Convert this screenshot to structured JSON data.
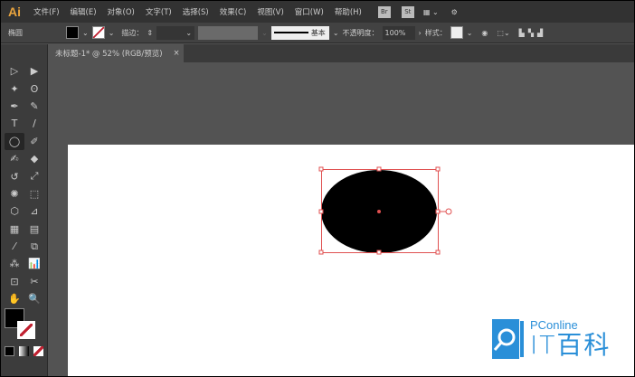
{
  "app": {
    "logo": "Ai"
  },
  "menu": [
    "文件(F)",
    "编辑(E)",
    "对象(O)",
    "文字(T)",
    "选择(S)",
    "效果(C)",
    "视图(V)",
    "窗口(W)",
    "帮助(H)"
  ],
  "menu_icons": [
    "Br",
    "St"
  ],
  "control": {
    "object_type": "椭圆",
    "stroke_label": "描边：",
    "stroke_style": "基本",
    "opacity_label": "不透明度：",
    "opacity_value": "100%",
    "style_label": "样式："
  },
  "document_tab": {
    "title": "未标题-1* @ 52% (RGB/预览)",
    "close": "×"
  },
  "tools": [
    "selection",
    "direct-selection",
    "magic-wand",
    "lasso",
    "pen",
    "curvature",
    "type",
    "line",
    "ellipse",
    "paintbrush",
    "shaper",
    "eraser",
    "rotate",
    "scale",
    "warp",
    "free-transform",
    "shape-builder",
    "perspective",
    "mesh",
    "gradient",
    "eyedropper",
    "blend",
    "symbol-sprayer",
    "column-graph",
    "artboard",
    "slice",
    "hand",
    "zoom"
  ],
  "tool_glyphs": [
    "▷",
    "▶",
    "✦",
    "ʘ",
    "✒",
    "✎",
    "T",
    "/",
    "◯",
    "✐",
    "✍",
    "◆",
    "↺",
    "⤢",
    "✺",
    "⬚",
    "⬡",
    "⊿",
    "▦",
    "▤",
    "⁄",
    "⧉",
    "⁂",
    "📊",
    "⊡",
    "✂",
    "✋",
    "🔍"
  ],
  "selected_tool": "ellipse",
  "colors": {
    "fill": "#000000",
    "stroke": "none",
    "selection": "#e05050"
  },
  "watermark": {
    "brand": "PConline",
    "name": "IT百科",
    "color": "#2a8fd8"
  }
}
